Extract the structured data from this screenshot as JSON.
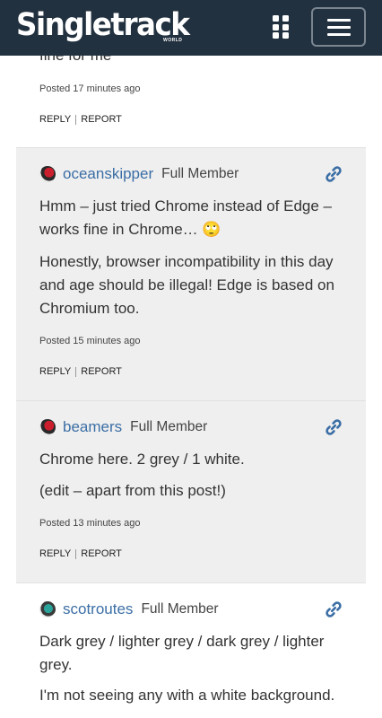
{
  "header": {
    "logo_text": "Singletrack",
    "logo_subtext": "WORLD",
    "apps_icon": "grid-icon",
    "menu_icon": "hamburger-icon",
    "background_color": "#22313f"
  },
  "posts": [
    {
      "text": [
        "fine for me"
      ],
      "timestamp": "Posted 17 minutes ago",
      "reply_label": "REPLY",
      "report_label": "REPORT"
    },
    {
      "author": "oceanskipper",
      "role": "Full Member",
      "avatar": "red-avatar",
      "text": [
        "Hmm – just tried Chrome instead of Edge – works fine in Chrome… 🙄",
        "Honestly, browser incompatibility in this day and age should be illegal! Edge is based on Chromium too."
      ],
      "timestamp": "Posted 15 minutes ago",
      "reply_label": "REPLY",
      "report_label": "REPORT"
    },
    {
      "author": "beamers",
      "role": "Full Member",
      "avatar": "red-avatar",
      "text": [
        "Chrome here. 2 grey / 1 white.",
        "(edit – apart from this post!)"
      ],
      "timestamp": "Posted 13 minutes ago",
      "reply_label": "REPLY",
      "report_label": "REPORT"
    },
    {
      "author": "scotroutes",
      "role": "Full Member",
      "avatar": "teal-avatar",
      "text": [
        "Dark grey / lighter grey / dark grey / lighter grey.",
        "I'm not seeing any with a white background."
      ]
    }
  ],
  "colors": {
    "author_link": "#3b6ea5",
    "post_grey": "#efefef",
    "post_white": "#ffffff"
  }
}
